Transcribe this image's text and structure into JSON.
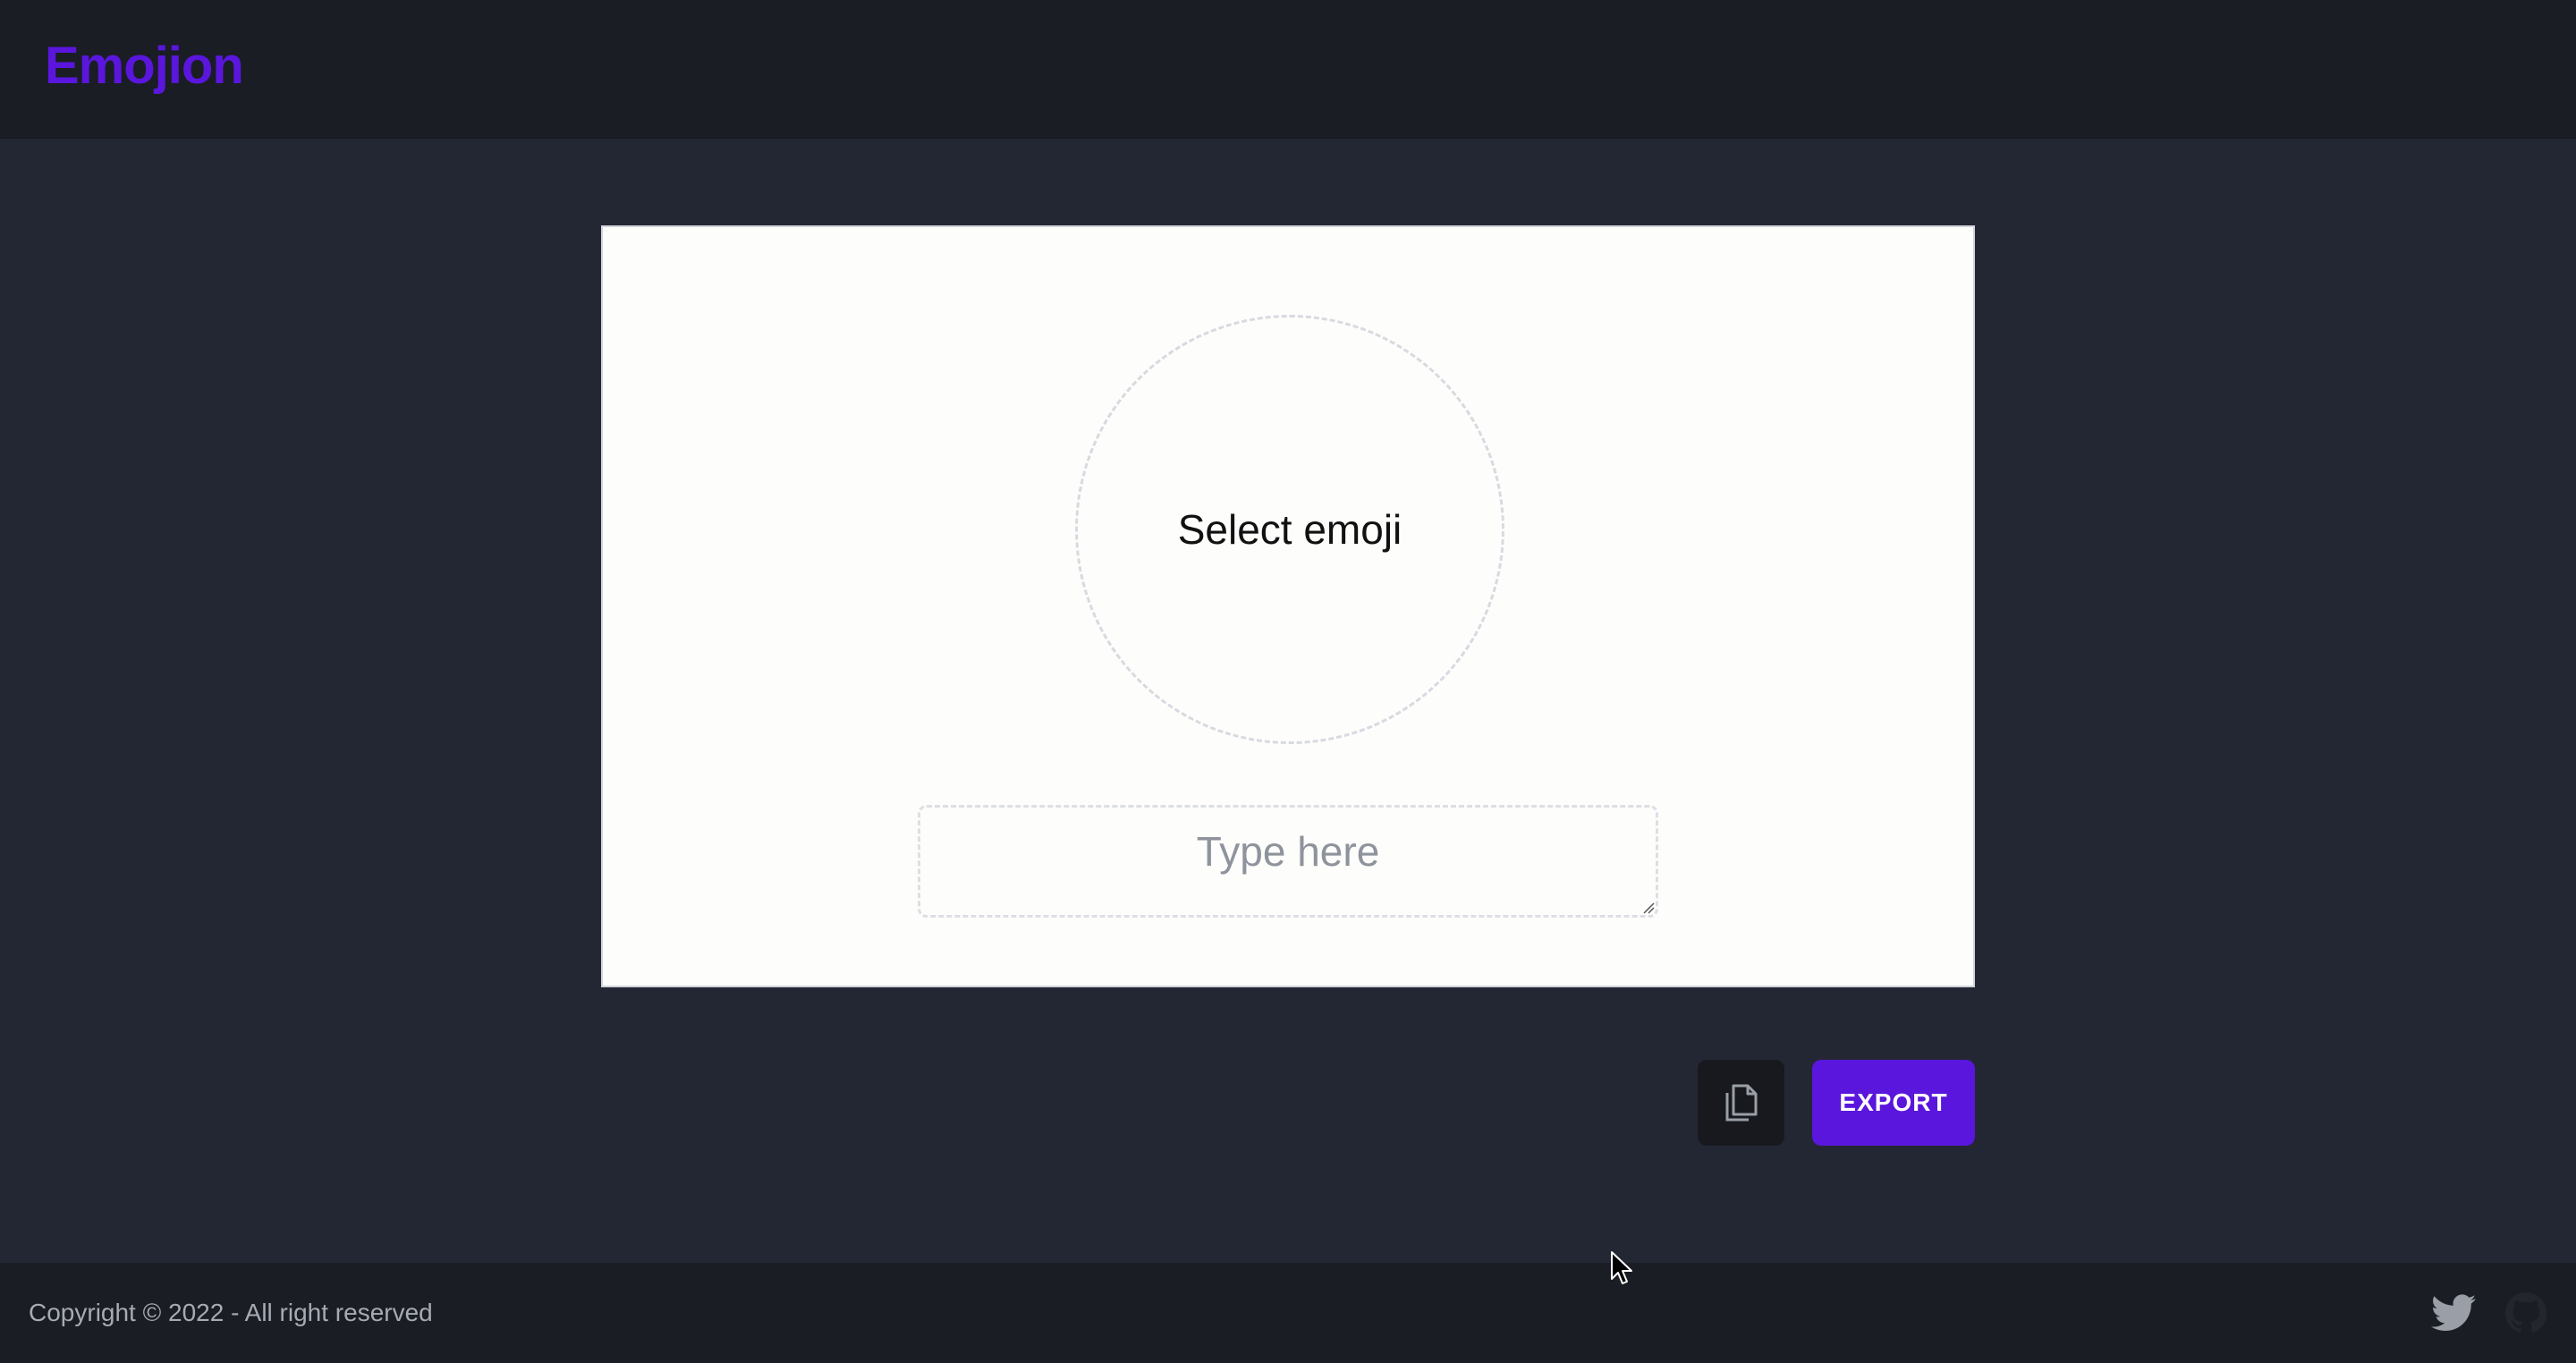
{
  "header": {
    "brand": "Emojion"
  },
  "editor": {
    "select_emoji_label": "Select emoji",
    "text_placeholder": "Type here",
    "text_value": ""
  },
  "actions": {
    "copy_icon": "copy-icon",
    "export_label": "EXPORT"
  },
  "footer": {
    "copyright": "Copyright © 2022 - All right reserved",
    "social_icons": [
      "twitter-icon",
      "github-icon"
    ]
  },
  "colors": {
    "brand": "#5a16dd",
    "background": "#222733",
    "bar": "#1a1d23",
    "card": "#fdfdfb"
  }
}
